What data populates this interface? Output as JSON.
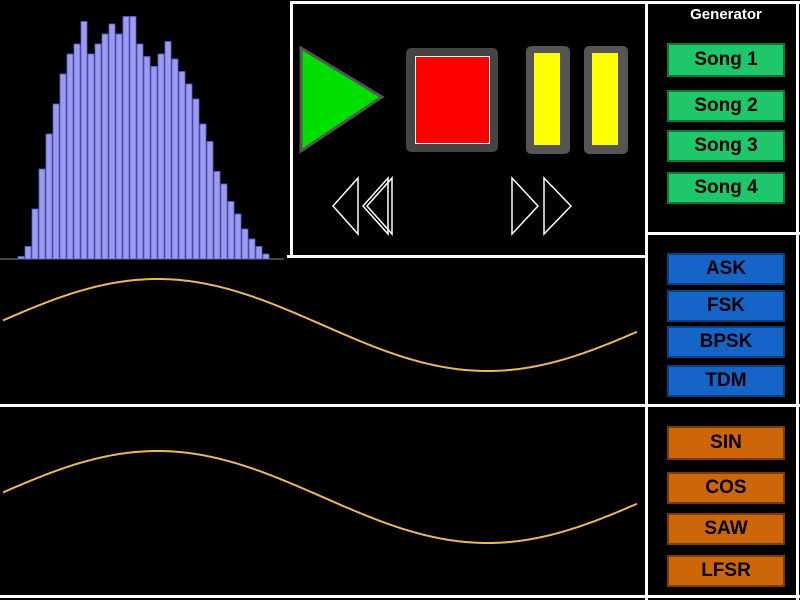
{
  "sidebar": {
    "title": "Generator",
    "songs": [
      "Song 1",
      "Song 2",
      "Song 3",
      "Song 4"
    ],
    "modulations": [
      "ASK",
      "FSK",
      "BPSK",
      "TDM"
    ],
    "waveforms": [
      "SIN",
      "COS",
      "SAW",
      "LFSR"
    ]
  },
  "transport": {
    "play_color": "#00e000",
    "stop_color": "#ff0000",
    "pause_color": "#ffff00"
  },
  "histogram": {
    "bar_color": "#9b9bf0",
    "values": [
      0.01,
      0.05,
      0.2,
      0.36,
      0.5,
      0.62,
      0.74,
      0.82,
      0.86,
      0.95,
      0.82,
      0.86,
      0.9,
      0.94,
      0.9,
      0.97,
      0.97,
      0.86,
      0.81,
      0.77,
      0.82,
      0.87,
      0.8,
      0.75,
      0.7,
      0.64,
      0.54,
      0.47,
      0.35,
      0.3,
      0.23,
      0.18,
      0.12,
      0.08,
      0.05,
      0.02
    ]
  },
  "waves": {
    "color": "#e8b85a"
  }
}
